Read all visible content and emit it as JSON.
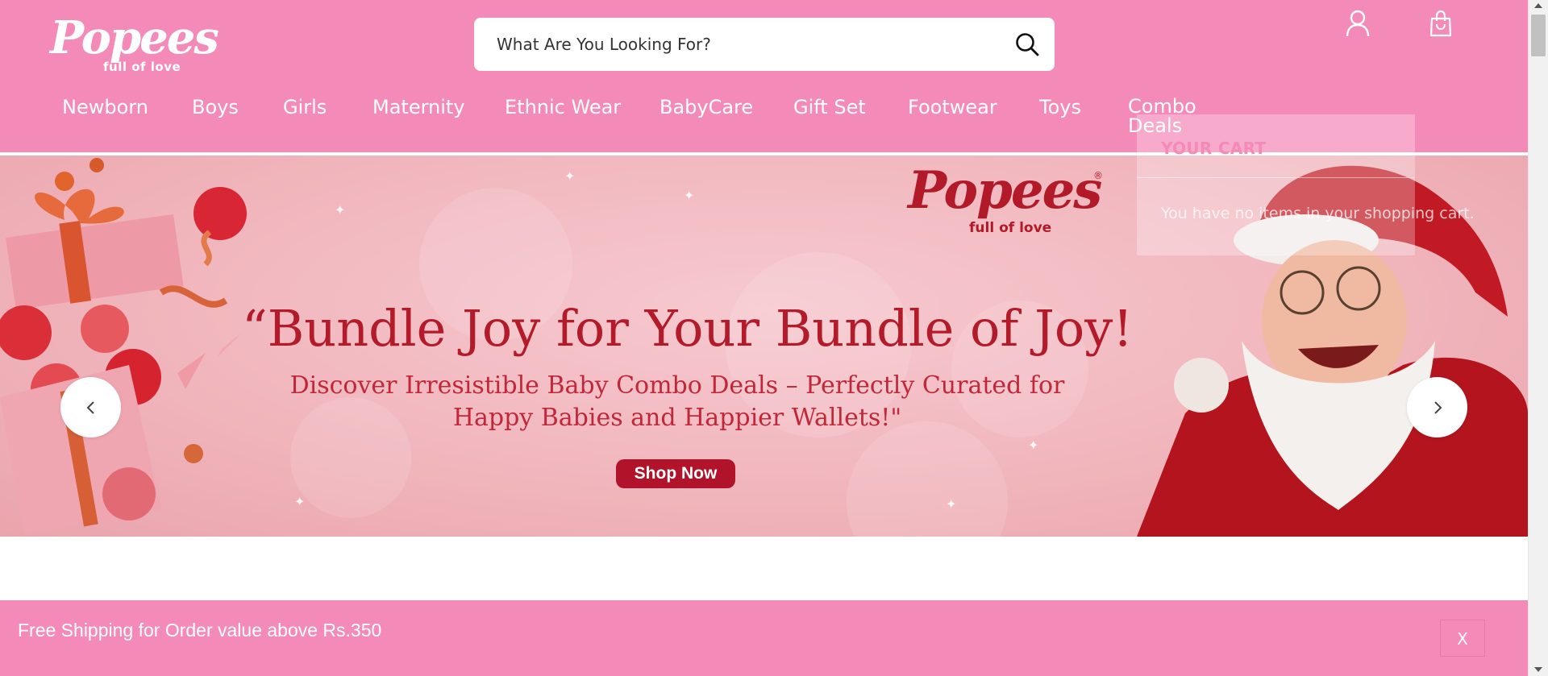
{
  "header": {
    "logo_text": "Popees",
    "logo_tagline": "full of love",
    "search_placeholder": "What Are You Looking For?",
    "icons": {
      "search": "search-icon",
      "account": "user-icon",
      "cart": "shopping-bag-icon"
    },
    "colors": {
      "header_bg": "#f48ab8",
      "text": "#ffffff"
    }
  },
  "nav": {
    "items": [
      "Newborn",
      "Boys",
      "Girls",
      "Maternity",
      "Ethnic Wear",
      "BabyCare",
      "Gift Set",
      "Footwear",
      "Toys",
      "Combo Deals"
    ]
  },
  "cart": {
    "title": "YOUR CART",
    "empty_message": "You have no items in your shopping cart."
  },
  "banner": {
    "brand_text": "Popees",
    "brand_tagline": "full of love",
    "brand_mark": "®",
    "headline": "“Bundle Joy for Your Bundle of Joy!",
    "subheadline": "Discover Irresistible Baby Combo Deals – Perfectly Curated for Happy Babies and Happier Wallets!\"",
    "cta_label": "Shop Now",
    "prev_icon": "chevron-left-icon",
    "next_icon": "chevron-right-icon",
    "colors": {
      "headline": "#b31b2b",
      "cta_bg": "#b0132a"
    }
  },
  "shipping_bar": {
    "message": "Free Shipping for Order value above Rs.350",
    "close_label": "X"
  }
}
